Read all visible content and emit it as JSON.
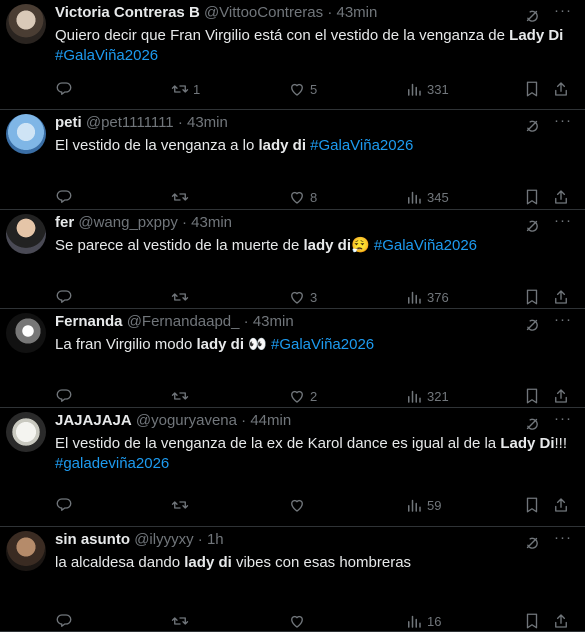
{
  "tweets": [
    {
      "name": "Victoria Contreras B",
      "handle": "@VittooContreras",
      "sep": "·",
      "time": "43min",
      "text": [
        {
          "t": "Quiero decir que Fran Virgilio está con el vestido de la venganza de ",
          "s": "normal"
        },
        {
          "t": "Lady Di",
          "s": "bold"
        },
        {
          "t": " ",
          "s": "normal"
        },
        {
          "t": "#GalaViña2026",
          "s": "tag"
        }
      ],
      "counts": {
        "reply": "",
        "retweet": "1",
        "like": "5",
        "views": "331"
      }
    },
    {
      "name": "peti",
      "handle": "@pet1111111",
      "sep": "·",
      "time": "43min",
      "text": [
        {
          "t": "El vestido de la venganza a lo ",
          "s": "normal"
        },
        {
          "t": "lady di",
          "s": "bold"
        },
        {
          "t": " ",
          "s": "normal"
        },
        {
          "t": "#GalaViña2026",
          "s": "tag"
        }
      ],
      "counts": {
        "reply": "",
        "retweet": "",
        "like": "8",
        "views": "345"
      }
    },
    {
      "name": "fer",
      "handle": "@wang_pxppy",
      "sep": "·",
      "time": "43min",
      "text": [
        {
          "t": "Se parece al vestido de la muerte de ",
          "s": "normal"
        },
        {
          "t": "lady di",
          "s": "bold"
        },
        {
          "t": "😮‍💨  ",
          "s": "normal"
        },
        {
          "t": "#GalaViña2026",
          "s": "tag"
        }
      ],
      "counts": {
        "reply": "",
        "retweet": "",
        "like": "3",
        "views": "376"
      }
    },
    {
      "name": "Fernanda",
      "handle": "@Fernandaapd_",
      "sep": "·",
      "time": "43min",
      "text": [
        {
          "t": "La fran Virgilio modo ",
          "s": "normal"
        },
        {
          "t": "lady di",
          "s": "bold"
        },
        {
          "t": " 👀 ",
          "s": "normal"
        },
        {
          "t": "#GalaViña2026",
          "s": "tag"
        }
      ],
      "counts": {
        "reply": "",
        "retweet": "",
        "like": "2",
        "views": "321"
      }
    },
    {
      "name": "JAJAJAJA",
      "handle": "@yoguryavena",
      "sep": "·",
      "time": "44min",
      "text": [
        {
          "t": "El vestido de la venganza de la ex de Karol dance es igual al de la ",
          "s": "normal"
        },
        {
          "t": "Lady Di",
          "s": "bold"
        },
        {
          "t": "!!! ",
          "s": "normal"
        },
        {
          "t": "#galadeviña2026",
          "s": "tag"
        }
      ],
      "counts": {
        "reply": "",
        "retweet": "",
        "like": "",
        "views": "59"
      }
    },
    {
      "name": "sin asunto",
      "handle": "@ilyyyxy",
      "sep": "·",
      "time": "1h",
      "text": [
        {
          "t": "la alcaldesa dando ",
          "s": "normal"
        },
        {
          "t": "lady di",
          "s": "bold"
        },
        {
          "t": " vibes con esas hombreras",
          "s": "normal"
        }
      ],
      "counts": {
        "reply": "",
        "retweet": "",
        "like": "",
        "views": "16"
      }
    }
  ],
  "more_label": "···",
  "icons": {
    "reply": "reply-icon",
    "retweet": "retweet-icon",
    "like": "like-icon",
    "views": "views-icon",
    "bookmark": "bookmark-icon",
    "share": "share-icon",
    "grok": "grok-icon"
  },
  "colors": {
    "background": "#000000",
    "text": "#e7e9ea",
    "muted": "#71767b",
    "link": "#1d9bf0",
    "divider": "#2f3336"
  }
}
